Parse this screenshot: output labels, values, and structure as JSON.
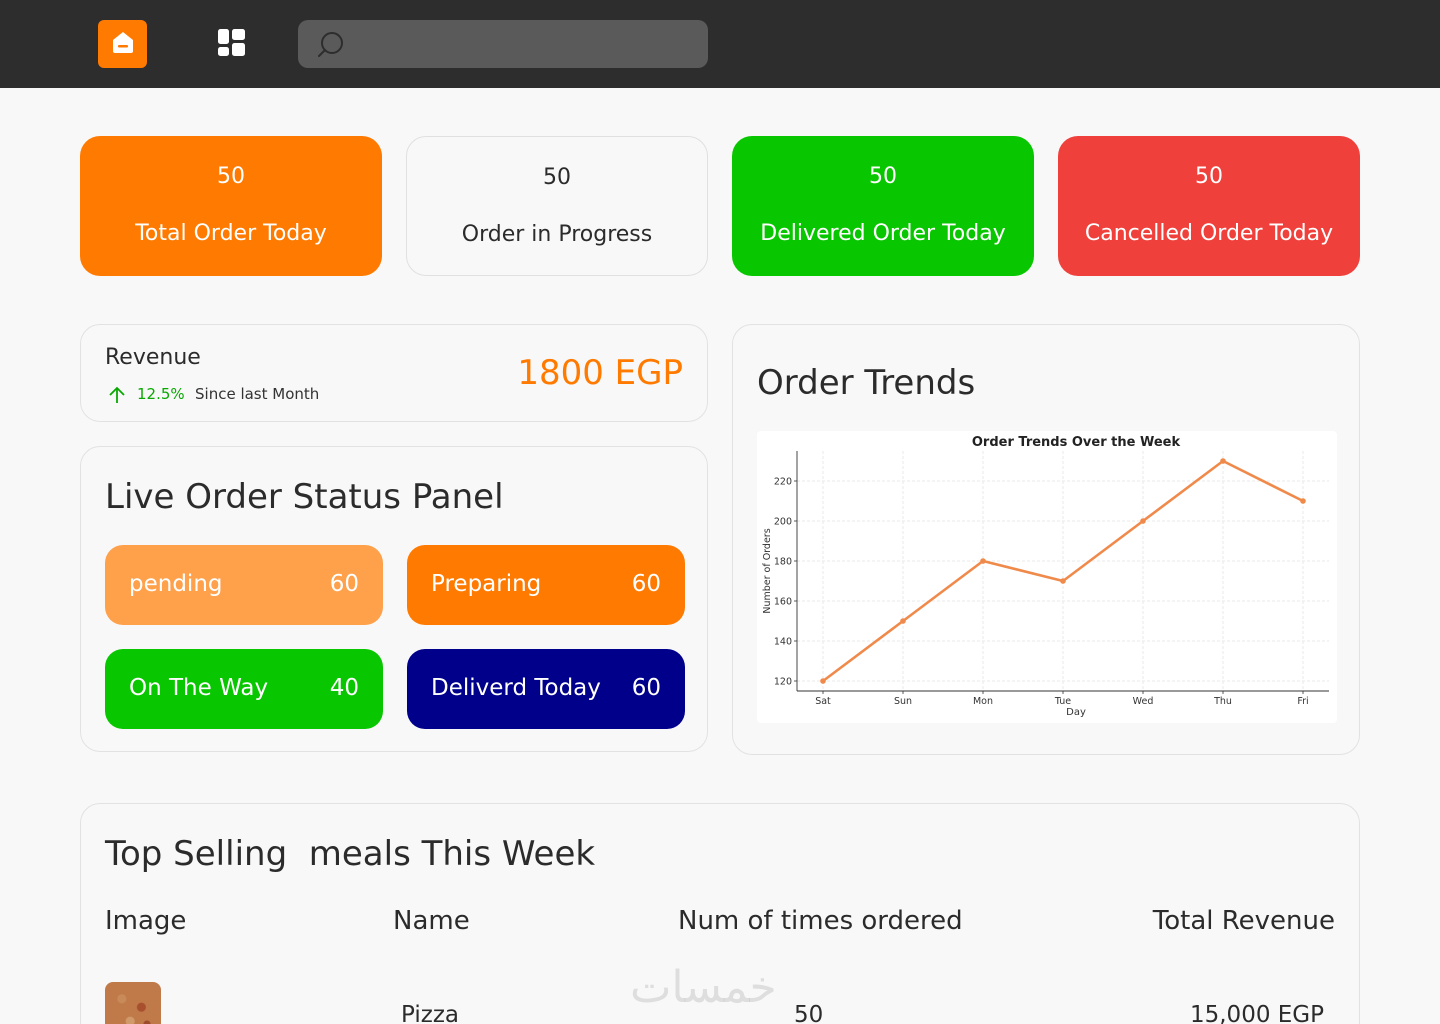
{
  "header": {
    "search": {
      "placeholder": "",
      "value": ""
    },
    "icons": {
      "home": "home-icon",
      "dashboard": "dashboard-grid-icon",
      "search": "search-icon"
    }
  },
  "stats": [
    {
      "value": "50",
      "label": "Total Order Today",
      "color": "#ff7a00"
    },
    {
      "value": "50",
      "label": "Order in Progress",
      "color": "#f8f8f8"
    },
    {
      "value": "50",
      "label": "Delivered Order Today",
      "color": "#08c600"
    },
    {
      "value": "50",
      "label": "Cancelled Order Today",
      "color": "#f0403b"
    }
  ],
  "revenue": {
    "title": "Revenue",
    "change": "12.5%",
    "since": "Since last Month",
    "amount": "1800 EGP"
  },
  "live_panel": {
    "title": "Live Order Status Panel",
    "statuses": [
      {
        "label": "pending",
        "value": "60",
        "color": "#ffa04a"
      },
      {
        "label": "Preparing",
        "value": "60",
        "color": "#ff7a00"
      },
      {
        "label": "On The Way",
        "value": "40",
        "color": "#08c600"
      },
      {
        "label": "Deliverd Today",
        "value": "60",
        "color": "#00008b"
      }
    ]
  },
  "trends": {
    "title": "Order Trends"
  },
  "chart_data": {
    "type": "line",
    "title": "Order Trends Over the Week",
    "xlabel": "Day",
    "ylabel": "Number of Orders",
    "categories": [
      "Sat",
      "Sun",
      "Mon",
      "Tue",
      "Wed",
      "Thu",
      "Fri"
    ],
    "values": [
      120,
      150,
      180,
      170,
      200,
      230,
      210
    ],
    "yticks": [
      120,
      140,
      160,
      180,
      200,
      220
    ],
    "ylim": [
      115,
      235
    ],
    "grid": true,
    "color": "#f08a4b"
  },
  "top_selling": {
    "title": "Top Selling  meals This Week",
    "columns": [
      "Image",
      "Name",
      "Num of times ordered",
      "Total Revenue"
    ],
    "rows": [
      {
        "image": "pizza-image",
        "name": "Pizza",
        "count": "50",
        "revenue": "15,000 EGP"
      }
    ]
  },
  "watermark": "خمسات"
}
